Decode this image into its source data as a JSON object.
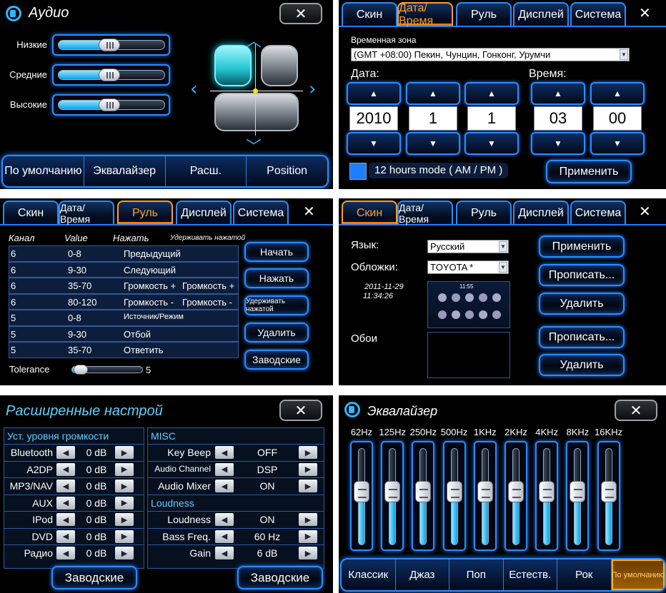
{
  "audio": {
    "title": "Аудио",
    "close": "✕",
    "sliders": [
      {
        "label": "Низкие",
        "level_pct": 48
      },
      {
        "label": "Средние",
        "level_pct": 48
      },
      {
        "label": "Высокие",
        "level_pct": 48
      }
    ],
    "tabs": [
      "По умолчанию",
      "Эквалайзер",
      "Расш.",
      "Position"
    ]
  },
  "datetime": {
    "tabs": [
      "Скин",
      "Дата/Время",
      "Руль",
      "Дисплей",
      "Система"
    ],
    "active_tab": "Дата/Время",
    "close": "✕",
    "timezone_label": "Временная зона",
    "timezone_value": "(GMT +08:00) Пекин, Чунцин, Гонконг, Урумчи",
    "date_label": "Дата:",
    "time_label": "Время:",
    "date_values": [
      "2010",
      "1",
      "1"
    ],
    "time_values": [
      "03",
      "00"
    ],
    "mode_label": "12 hours mode ( AM / PM )",
    "apply": "Применить"
  },
  "steering": {
    "tabs": [
      "Скин",
      "Дата/Время",
      "Руль",
      "Дисплей",
      "Система"
    ],
    "active_tab": "Руль",
    "close": "✕",
    "headers": [
      "Канал",
      "Value",
      "Нажать",
      "Удерживать нажатой"
    ],
    "rows": [
      {
        "channel": "6",
        "value": "0-8",
        "press": "Предыдущий",
        "hold": ""
      },
      {
        "channel": "6",
        "value": "9-30",
        "press": "Следующий",
        "hold": ""
      },
      {
        "channel": "6",
        "value": "35-70",
        "press": "Громкость +",
        "hold": "Громкость +"
      },
      {
        "channel": "6",
        "value": "80-120",
        "press": "Громкость -",
        "hold": "Громкость -"
      },
      {
        "channel": "5",
        "value": "0-8",
        "press": "Источник/Режим",
        "hold": ""
      },
      {
        "channel": "5",
        "value": "9-30",
        "press": "Отбой",
        "hold": ""
      },
      {
        "channel": "5",
        "value": "35-70",
        "press": "Ответить",
        "hold": ""
      }
    ],
    "buttons": [
      "Начать",
      "Нажать",
      "Удерживать нажатой",
      "Удалить",
      "Заводские"
    ],
    "tolerance_label": "Tolerance",
    "tolerance_value": "5",
    "tolerance_level_pct": 12
  },
  "skin": {
    "tabs": [
      "Скин",
      "Дата/Время",
      "Руль",
      "Дисплей",
      "Система"
    ],
    "active_tab": "Скин",
    "close": "✕",
    "language_label": "Язык:",
    "language_value": "Русский",
    "skins_label": "Обложки:",
    "skins_value": "TOYOTA *",
    "date": "2011-11-29",
    "time": "11:34:26",
    "preview_clock": "11:55",
    "wallpaper_label": "Обои",
    "buttons": [
      "Применить",
      "Прописать...",
      "Удалить",
      "Прописать...",
      "Удалить"
    ]
  },
  "advanced": {
    "title": "Расширенные настрой",
    "close": "✕",
    "left_header": "Уст. уровня  громкости",
    "left_rows": [
      {
        "label": "Bluetooth",
        "value": "0 dB"
      },
      {
        "label": "A2DP",
        "value": "0 dB"
      },
      {
        "label": "MP3/NAV",
        "value": "0 dB"
      },
      {
        "label": "AUX",
        "value": "0 dB"
      },
      {
        "label": "IPod",
        "value": "0 dB"
      },
      {
        "label": "DVD",
        "value": "0 dB"
      },
      {
        "label": "Радио",
        "value": "0 dB"
      }
    ],
    "misc_header": "MISC",
    "misc_rows": [
      {
        "label": "Key Beep",
        "value": "OFF"
      },
      {
        "label": "Audio Channel",
        "value": "DSP"
      },
      {
        "label": "Audio Mixer",
        "value": "ON"
      }
    ],
    "loudness_header": "Loudness",
    "loudness_rows": [
      {
        "label": "Loudness",
        "value": "ON"
      },
      {
        "label": "Bass Freq.",
        "value": "60 Hz"
      },
      {
        "label": "Gain",
        "value": "6 dB"
      }
    ],
    "left_button": "Заводские",
    "right_button": "Заводские"
  },
  "equalizer": {
    "title": "Эквалайзер",
    "close": "✕",
    "bands": [
      {
        "freq": "62Hz",
        "level_pct": 55
      },
      {
        "freq": "125Hz",
        "level_pct": 55
      },
      {
        "freq": "250Hz",
        "level_pct": 55
      },
      {
        "freq": "500Hz",
        "level_pct": 55
      },
      {
        "freq": "1KHz",
        "level_pct": 55
      },
      {
        "freq": "2KHz",
        "level_pct": 55
      },
      {
        "freq": "4KHz",
        "level_pct": 55
      },
      {
        "freq": "8KHz",
        "level_pct": 55
      },
      {
        "freq": "16KHz",
        "level_pct": 55
      }
    ],
    "presets": [
      "Классик",
      "Джаз",
      "Поп",
      "Естеств.",
      "Рок",
      "По умолчанию"
    ],
    "active_preset": "По умолчанию"
  }
}
